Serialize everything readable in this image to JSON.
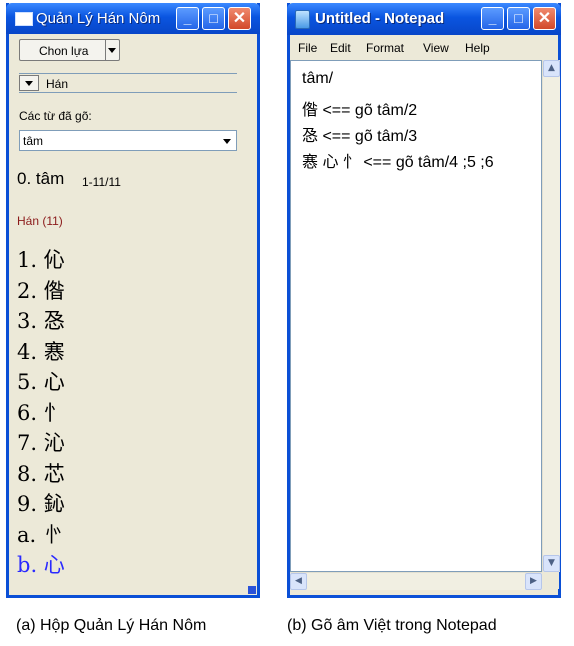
{
  "left_window": {
    "title": "Quản Lý Hán Nôm",
    "choose_button": "Chon lựa",
    "han_dropdown": "Hán",
    "typed_words_label": "Các từ đã gõ:",
    "typed_words_value": "tâm",
    "current_word": "0. tâm",
    "range": "1-11/11",
    "group_label": "Hán (11)",
    "group_color": "#8b1a1a",
    "candidates": [
      "1. 伈",
      "2. 偺",
      "3. 㤂",
      "4. 㥶",
      "5. 心",
      "6. 忄",
      "7. 沁",
      "8. 芯",
      "9. 鈊",
      "a. 㣺",
      "b. 心"
    ],
    "selected_index": 10,
    "selected_color": "#2a2aff"
  },
  "right_window": {
    "title": "Untitled - Notepad",
    "menu": [
      "File",
      "Edit",
      "Format",
      "View",
      "Help"
    ],
    "lines": [
      "tâm/",
      "偺   <== gõ tâm/2",
      "㤂   <== gõ tâm/3",
      "㥶 心 忄 <== gõ tâm/4 ;5 ;6"
    ]
  },
  "captions": {
    "left": "(a) Hộp Quản Lý Hán Nôm",
    "right": "(b) Gõ âm Việt trong Notepad"
  }
}
